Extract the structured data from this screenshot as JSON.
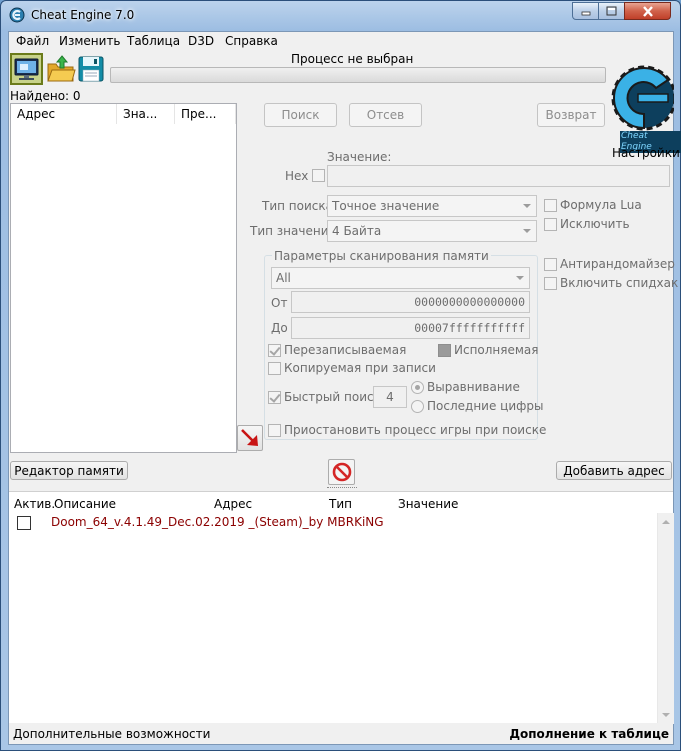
{
  "window": {
    "title": "Cheat Engine 7.0"
  },
  "menu": [
    "Файл",
    "Изменить",
    "Таблица",
    "D3D",
    "Справка"
  ],
  "process": {
    "label": "Процесс не выбран"
  },
  "found": {
    "label": "Найдено: 0"
  },
  "results_columns": [
    "Адрес",
    "Зна...",
    "Пре..."
  ],
  "scan_buttons": {
    "first": "Поиск",
    "next": "Отсев",
    "undo": "Возврат"
  },
  "logo": {
    "text": "Cheat Engine",
    "settings_label": "Настройки"
  },
  "value": {
    "label": "Значение:",
    "hex_label": "Hex",
    "input_value": ""
  },
  "scan_type": {
    "label": "Тип поиска",
    "selected": "Точное значение"
  },
  "value_type": {
    "label": "Тип значения",
    "selected": "4 Байта"
  },
  "right_options": {
    "lua_formula": "Формула Lua",
    "exclude": "Исключить",
    "unrandomizer": "Антирандомайзер",
    "speedhack": "Включить спидхак"
  },
  "memory_scan": {
    "title": "Параметры сканирования памяти",
    "region": "All",
    "from_label": "От",
    "from_value": "0000000000000000",
    "to_label": "До",
    "to_value": "00007fffffffffff",
    "writable": "Перезаписываемая",
    "executable": "Исполняемая",
    "copy_on_write": "Копируемая при записи",
    "fast_scan": "Быстрый поиск",
    "fast_scan_value": "4",
    "alignment": "Выравнивание",
    "last_digits": "Последние цифры",
    "pause_game": "Приостановить процесс игры при поиске"
  },
  "memory_view_button": "Редактор памяти",
  "add_address_button": "Добавить адрес",
  "table_columns": [
    "Актив.",
    "Описание",
    "Адрес",
    "Тип",
    "Значение"
  ],
  "table_rows": [
    {
      "active": false,
      "description": "Doom_64_v.4.1.49_Dec.02.2019 _(Steam)_by MBRKiNG",
      "address": "",
      "type": "",
      "value": ""
    }
  ],
  "footer": {
    "left": "Дополнительные возможности",
    "right": "Дополнение к таблице"
  },
  "colors": {
    "description_text": "#8b0000",
    "process_icon_border": "#6b7b1a"
  }
}
